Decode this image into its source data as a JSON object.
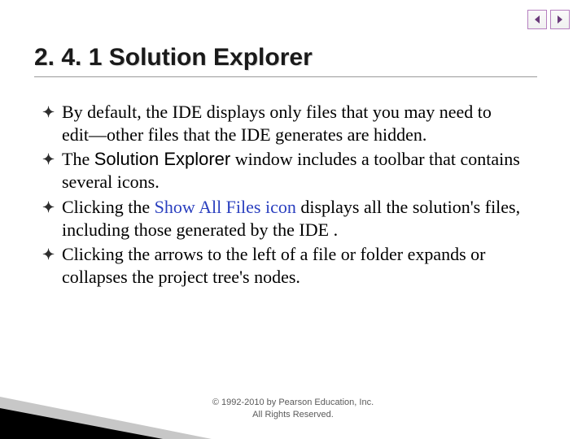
{
  "nav": {
    "prev_icon": "nav-prev",
    "next_icon": "nav-next"
  },
  "title": "2. 4. 1 Solution Explorer",
  "bullets": [
    {
      "runs": [
        {
          "text": "By default, the IDE displays only files that you may need to edit—other files that the IDE generates are hidden."
        }
      ]
    },
    {
      "runs": [
        {
          "text": "The "
        },
        {
          "text": "Solution Explorer",
          "cls": "sans-b"
        },
        {
          "text": " window includes a toolbar that contains several icons."
        }
      ]
    },
    {
      "runs": [
        {
          "text": "Clicking the "
        },
        {
          "text": "Show All Files icon ",
          "cls": "link"
        },
        {
          "text": " displays all the solution's files, including those generated by the IDE ."
        }
      ]
    },
    {
      "runs": [
        {
          "text": "Clicking the arrows to the left of a file or folder expands or collapses the project tree's nodes."
        }
      ]
    }
  ],
  "footer": {
    "line1": "© 1992-2010 by Pearson Education, Inc.",
    "line2": "All Rights Reserved."
  },
  "bullet_glyph": "✦"
}
